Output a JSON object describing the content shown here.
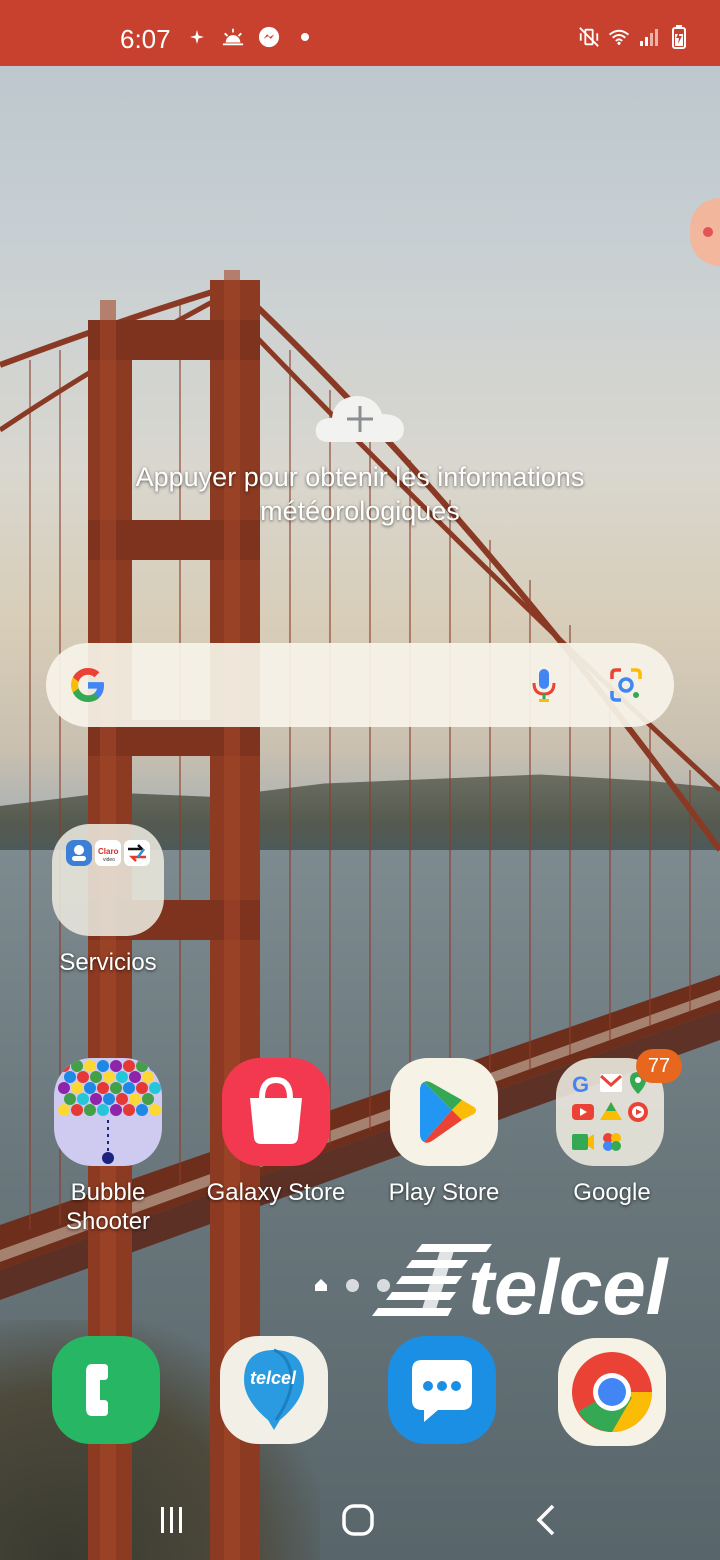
{
  "status_bar": {
    "time": "6:07",
    "left_icons": [
      "sparkle-icon",
      "sunrise-icon",
      "messenger-icon",
      "dot-icon"
    ],
    "right_icons": [
      "mute-vibrate-icon",
      "wifi-icon",
      "signal-icon",
      "battery-charging-icon"
    ],
    "background": "#c8412e"
  },
  "weather_widget": {
    "icon": "cloud-plus-icon",
    "text": "Appuyer pour obtenir les informations météorologiques"
  },
  "search_bar": {
    "icons": [
      "google-g-icon",
      "microphone-icon",
      "google-lens-icon"
    ]
  },
  "folder": {
    "label": "Servicios",
    "mini_apps": [
      "weather-app-icon",
      "claro-video-icon",
      "transfer-icon"
    ]
  },
  "apps": [
    {
      "label": "Bubble\nShooter",
      "icon": "bubble-shooter-icon"
    },
    {
      "label": "Galaxy Store",
      "icon": "galaxy-store-icon"
    },
    {
      "label": "Play Store",
      "icon": "play-store-icon"
    },
    {
      "label": "Google",
      "icon": "google-folder-icon",
      "badge": "77"
    }
  ],
  "page_indicator": {
    "pages": 3,
    "current": "home"
  },
  "watermark": "telcel",
  "dock": [
    {
      "name": "phone",
      "icon": "phone-icon"
    },
    {
      "name": "telcel",
      "icon": "telcel-balloon-icon",
      "text": "telcel"
    },
    {
      "name": "messages",
      "icon": "messages-icon"
    },
    {
      "name": "chrome",
      "icon": "chrome-icon"
    }
  ],
  "navigation": [
    "recents-button",
    "home-button",
    "back-button"
  ]
}
